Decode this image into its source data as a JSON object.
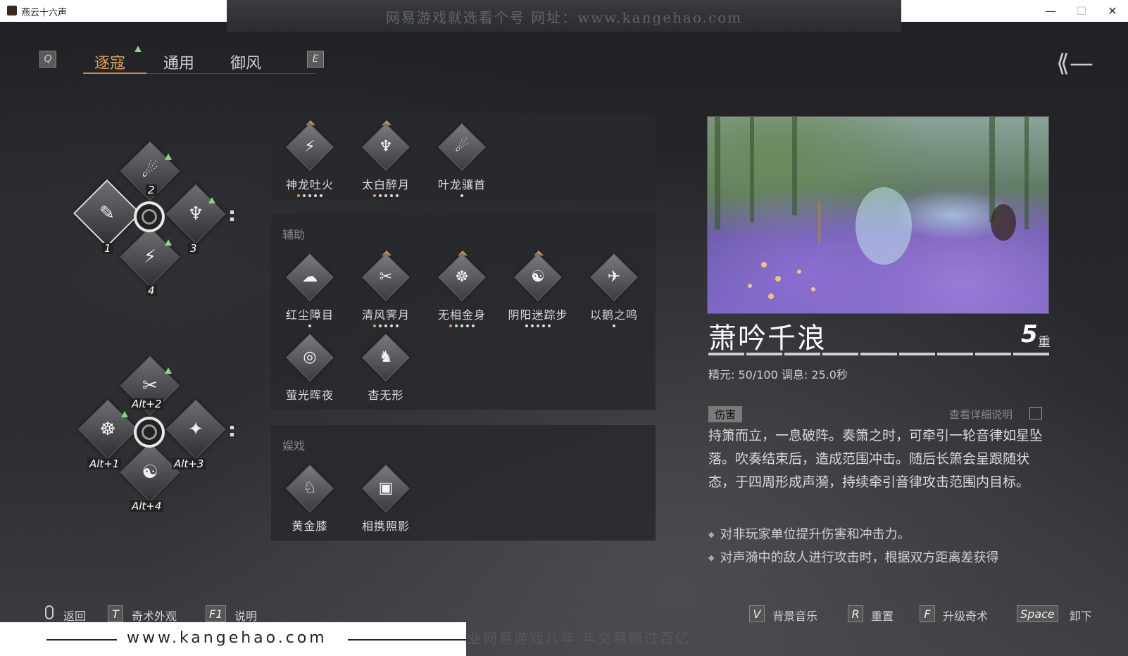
{
  "window": {
    "title": "燕云十六声",
    "minimize": "—",
    "maximize": "☐",
    "close": "✕"
  },
  "banner": "网易游戏就选看个号   网址：www.kangehao.com",
  "tabs": {
    "prev_key": "Q",
    "next_key": "E",
    "items": [
      "逐寇",
      "通用",
      "御风"
    ],
    "active": 0
  },
  "loadout_top": {
    "slots": [
      {
        "num": "1",
        "icon": "✎"
      },
      {
        "num": "2",
        "icon": "☄"
      },
      {
        "num": "3",
        "icon": "♆"
      },
      {
        "num": "4",
        "icon": "⚡"
      }
    ]
  },
  "loadout_bottom": {
    "slots": [
      {
        "num": "Alt+1",
        "icon": "☸"
      },
      {
        "num": "Alt+2",
        "icon": "✂"
      },
      {
        "num": "Alt+3",
        "icon": "✦"
      },
      {
        "num": "Alt+4",
        "icon": "☯"
      }
    ]
  },
  "groups": {
    "attack": {
      "skills": [
        {
          "name": "神龙吐火",
          "icon": "⚡",
          "dots": [
            1,
            0,
            0,
            0,
            0
          ]
        },
        {
          "name": "太白醉月",
          "icon": "♆",
          "dots": [
            1,
            0,
            0,
            0,
            0
          ]
        },
        {
          "name": "叶龙骧首",
          "icon": "☄",
          "dots": [
            0
          ]
        }
      ]
    },
    "assist": {
      "label": "辅助",
      "skills": [
        {
          "name": "红尘障目",
          "icon": "☁",
          "dots": [
            0
          ]
        },
        {
          "name": "清风霁月",
          "icon": "✂",
          "dots": [
            1,
            0,
            0,
            0,
            0
          ]
        },
        {
          "name": "无相金身",
          "icon": "☸",
          "dots": [
            1,
            0,
            0,
            0,
            0
          ]
        },
        {
          "name": "阴阳迷踪步",
          "icon": "☯",
          "dots": [
            0,
            0,
            0,
            0,
            0
          ]
        },
        {
          "name": "以鹅之鸣",
          "icon": "✈",
          "dots": [
            0
          ]
        },
        {
          "name": "萤光晖夜",
          "icon": "◎",
          "dots": []
        },
        {
          "name": "杳无形",
          "icon": "♞",
          "dots": []
        }
      ]
    },
    "fun": {
      "label": "娱戏",
      "skills": [
        {
          "name": "黄金膝",
          "icon": "♘",
          "dots": []
        },
        {
          "name": "相携照影",
          "icon": "▣",
          "dots": []
        }
      ]
    }
  },
  "detail": {
    "title": "萧吟千浪",
    "level": "5",
    "level_unit": "重",
    "level_progress": 1.0,
    "stats": "精元: 50/100   调息: 25.0秒",
    "tag": "伤害",
    "more_link": "查看详细说明",
    "description": "持箫而立，一息破阵。奏箫之时，可牵引一轮音律如星坠落。吹奏结束后，造成范围冲击。随后长箫会呈跟随状态，于四周形成声漪，持续牵引音律攻击范围内目标。",
    "bullets": [
      "对非玩家单位提升伤害和冲击力。",
      "对声漪中的敌人进行攻击时，根据双方距离差获得"
    ]
  },
  "footer": {
    "left": [
      {
        "key": "",
        "label": "返回"
      },
      {
        "key": "T",
        "label": "奇术外观"
      },
      {
        "key": "F1",
        "label": "说明"
      }
    ],
    "right": [
      {
        "key": "V",
        "label": "背景音乐"
      },
      {
        "key": "R",
        "label": "重置"
      },
      {
        "key": "F",
        "label": "升级奇术"
      },
      {
        "key": "Space",
        "label": "卸下"
      }
    ]
  },
  "watermark": {
    "url": "www.kangehao.com",
    "ghost": "看个号专业网易游戏八年  年交易额过百亿"
  },
  "colors": {
    "accent": "#d8a25a",
    "upgrade": "#8fd08a",
    "dot_on": "#e8935a"
  }
}
